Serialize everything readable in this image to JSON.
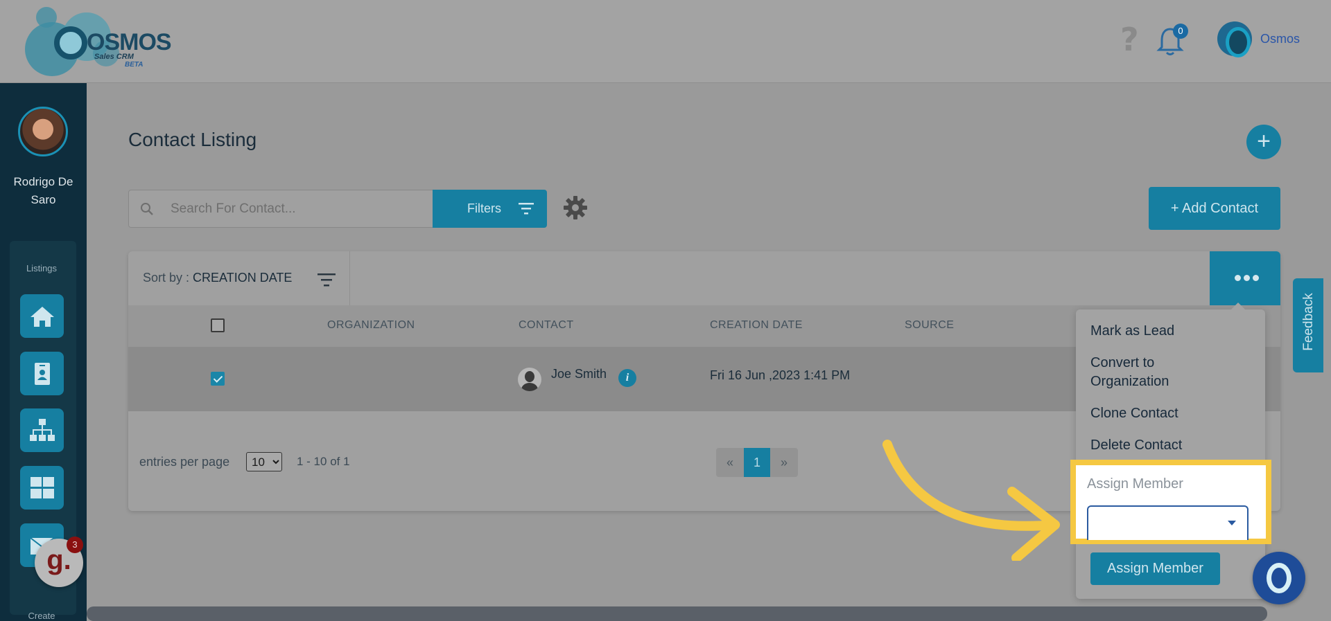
{
  "header": {
    "logo": {
      "word": "OSMOS",
      "sub": "Sales CRM",
      "beta": "BETA"
    },
    "notifications_count": "0",
    "user_name": "Osmos"
  },
  "sidebar": {
    "user_name": "Rodrigo De Saro",
    "section_label": "Listings",
    "items": [
      {
        "icon": "home-icon"
      },
      {
        "icon": "contact-card-icon"
      },
      {
        "icon": "org-chart-icon"
      },
      {
        "icon": "grid-icon"
      },
      {
        "icon": "mail-icon"
      }
    ],
    "create_label": "Create",
    "g_badge": {
      "letter": "g.",
      "count": "3"
    }
  },
  "page": {
    "title": "Contact Listing",
    "search_placeholder": "Search For Contact...",
    "filters_label": "Filters",
    "add_contact_label": "+ Add Contact",
    "fab_add": "+"
  },
  "table": {
    "sort_prefix": "Sort by : ",
    "sort_value": "CREATION DATE",
    "columns": [
      "ORGANIZATION",
      "CONTACT",
      "CREATION DATE",
      "SOURCE"
    ],
    "rows": [
      {
        "organization": "",
        "contact": "Joe Smith",
        "creation_date": "Fri 16 Jun ,2023 1:41 PM",
        "source": "",
        "checked": true
      }
    ],
    "entries_label": "entries per page",
    "entries_value": "10",
    "range_text": "1 - 10 of 1",
    "pager": {
      "prev": "«",
      "current": "1",
      "next": "»"
    }
  },
  "actions_menu": {
    "items": [
      "Mark as Lead",
      "Convert to Organization",
      "Clone Contact",
      "Delete Contact"
    ],
    "assign_label": "Assign Member",
    "assign_button": "Assign Member"
  },
  "feedback_label": "Feedback",
  "colors": {
    "accent": "#167fa1",
    "highlight": "#f5c842",
    "sidebar": "#0e2d3d"
  }
}
